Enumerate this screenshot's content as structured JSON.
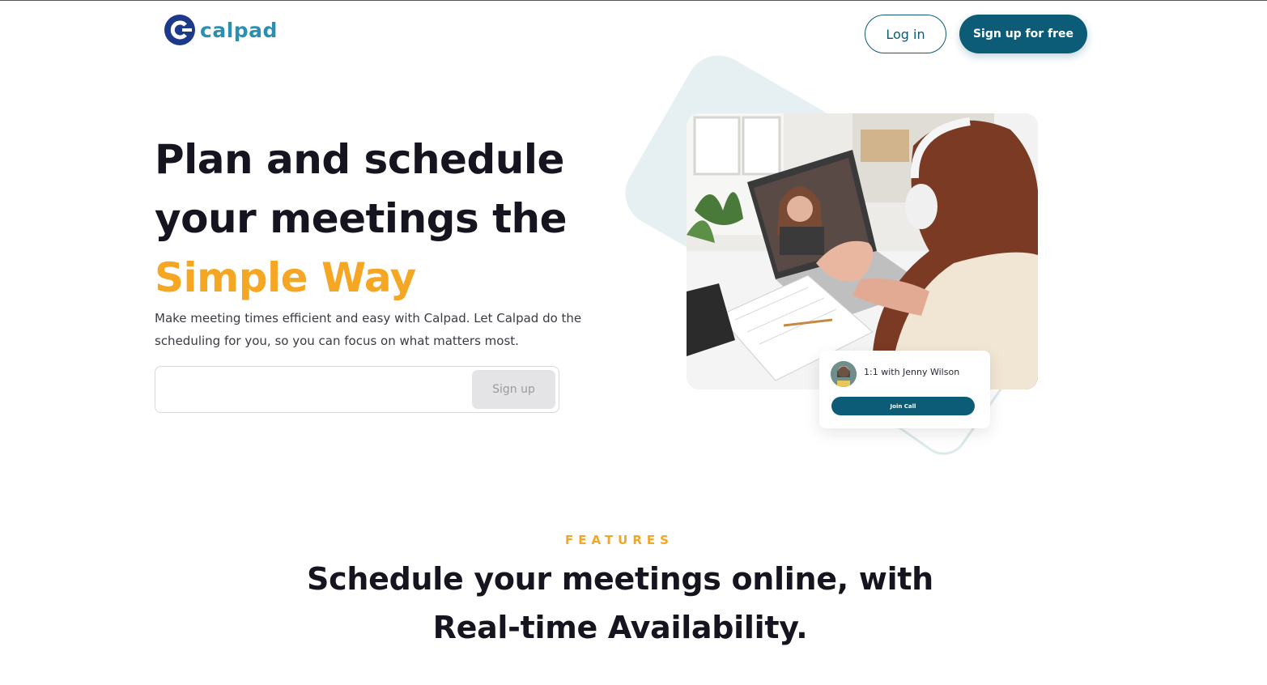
{
  "header": {
    "logo_text": "calpad",
    "login_label": "Log in",
    "signup_free_label": "Sign up for free"
  },
  "hero": {
    "title_line1": "Plan and schedule",
    "title_line2": "your meetings the",
    "title_accent": "Simple Way",
    "description": "Make meeting times efficient and easy with Calpad. Let Calpad do the scheduling for you, so you can focus on what matters most.",
    "email_placeholder": "",
    "signup_button": "Sign up"
  },
  "call_card": {
    "title": "1:1 with Jenny Wilson",
    "join_label": "Join Call"
  },
  "features": {
    "eyebrow": "FEATURES",
    "heading_line1": "Schedule your meetings online, with",
    "heading_line2": "Real-time Availability."
  },
  "colors": {
    "accent": "#f5a623",
    "brand": "#0d5c77",
    "text": "#16151f"
  }
}
